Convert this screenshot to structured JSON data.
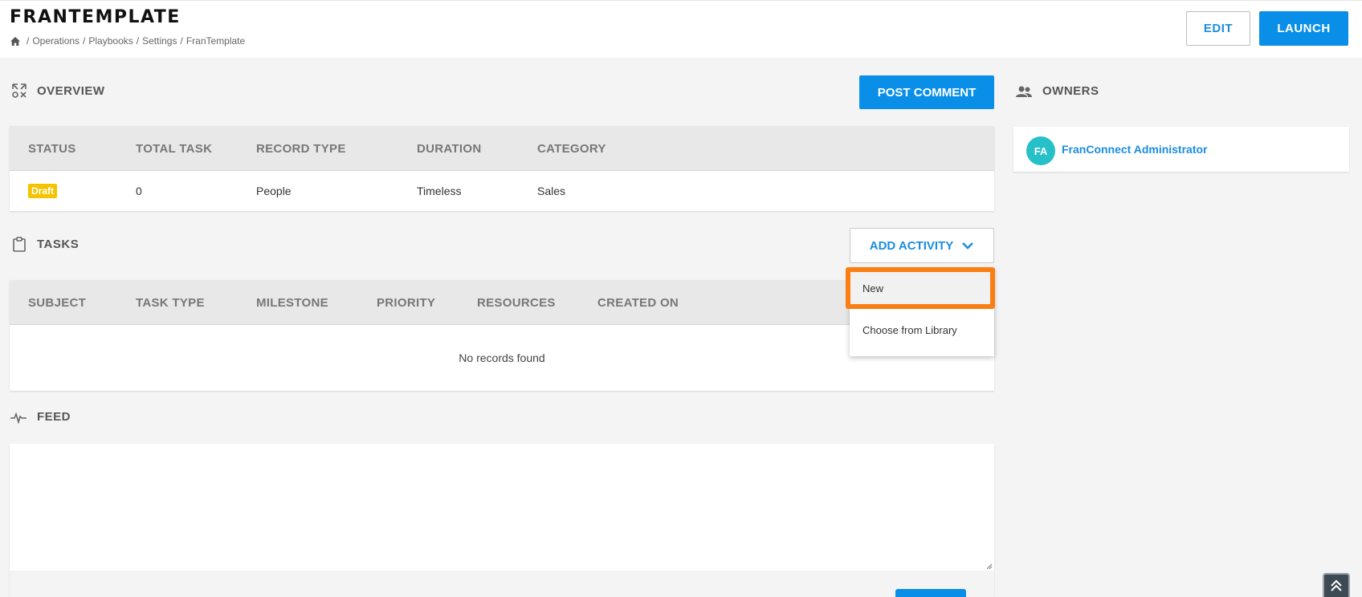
{
  "header": {
    "title": "FRANTEMPLATE",
    "breadcrumb": [
      "Operations",
      "Playbooks",
      "Settings",
      "FranTemplate"
    ],
    "breadcrumb_separator": "/",
    "edit_label": "EDIT",
    "launch_label": "LAUNCH"
  },
  "overview": {
    "title": "OVERVIEW",
    "post_comment_label": "POST COMMENT",
    "columns": [
      "STATUS",
      "TOTAL TASK",
      "RECORD TYPE",
      "DURATION",
      "CATEGORY"
    ],
    "row": {
      "status": "Draft",
      "total_task": "0",
      "record_type": "People",
      "duration": "Timeless",
      "category": "Sales"
    }
  },
  "tasks": {
    "title": "TASKS",
    "add_activity_label": "ADD ACTIVITY",
    "columns": [
      "SUBJECT",
      "TASK TYPE",
      "MILESTONE",
      "PRIORITY",
      "RESOURCES",
      "CREATED ON"
    ],
    "empty_text": "No records found",
    "dropdown": [
      "New",
      "Choose from Library"
    ]
  },
  "feed": {
    "title": "FEED"
  },
  "owners": {
    "title": "OWNERS",
    "items": [
      {
        "initials": "FA",
        "name": "FranConnect Administrator"
      }
    ]
  },
  "colors": {
    "primary": "#0a8fe8",
    "highlight": "#fb7e12",
    "draft_badge": "#f5c400",
    "avatar": "#26c0c9"
  }
}
